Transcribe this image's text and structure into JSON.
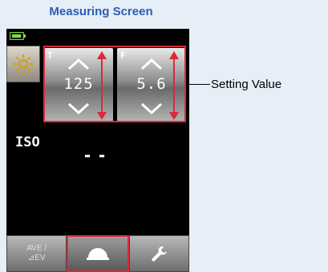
{
  "title": "Measuring Screen",
  "shutter": {
    "label": "T",
    "value": "125"
  },
  "aperture": {
    "label": "F",
    "value": "5.6"
  },
  "iso": {
    "label": "ISO",
    "value": "--"
  },
  "tabs": [
    {
      "label": "AVE /\n⊿EV",
      "icon": "",
      "active": false
    },
    {
      "label": "",
      "icon": "dome-icon",
      "active": true
    },
    {
      "label": "",
      "icon": "wrench-icon",
      "active": false
    }
  ],
  "callout": "Setting Value",
  "colors": {
    "highlight": "#d92a3a",
    "title": "#2b5db6",
    "battery": "#7ee03a"
  }
}
